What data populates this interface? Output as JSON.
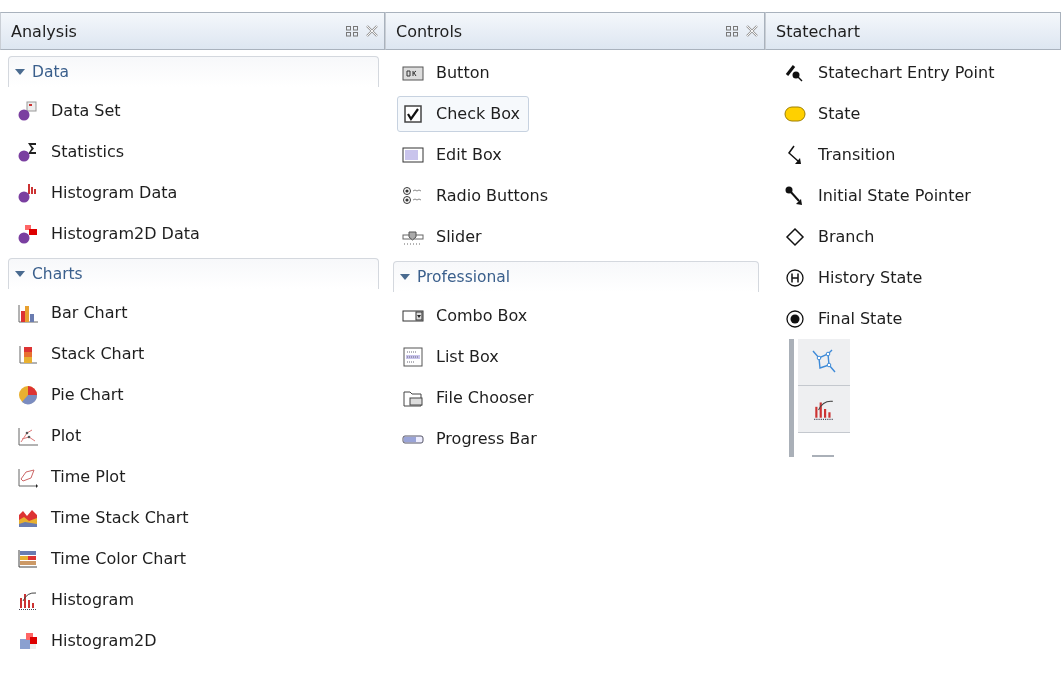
{
  "panels": [
    {
      "title": "Analysis",
      "show_buttons": true,
      "groups": [
        {
          "label": "Data",
          "expanded": true,
          "items": [
            {
              "label": "Data Set",
              "selected": false
            },
            {
              "label": "Statistics",
              "selected": false
            },
            {
              "label": "Histogram Data",
              "selected": false
            },
            {
              "label": "Histogram2D Data",
              "selected": false
            }
          ]
        },
        {
          "label": "Charts",
          "expanded": true,
          "items": [
            {
              "label": "Bar Chart",
              "selected": false
            },
            {
              "label": "Stack Chart",
              "selected": false
            },
            {
              "label": "Pie Chart",
              "selected": false
            },
            {
              "label": "Plot",
              "selected": false
            },
            {
              "label": "Time Plot",
              "selected": false
            },
            {
              "label": "Time Stack Chart",
              "selected": false
            },
            {
              "label": "Time Color Chart",
              "selected": false
            },
            {
              "label": "Histogram",
              "selected": false
            },
            {
              "label": "Histogram2D",
              "selected": false
            }
          ]
        }
      ]
    },
    {
      "title": "Controls",
      "show_buttons": true,
      "groups": [
        {
          "items": [
            {
              "label": "Button",
              "selected": false
            },
            {
              "label": "Check Box",
              "selected": true
            },
            {
              "label": "Edit Box",
              "selected": false
            },
            {
              "label": "Radio Buttons",
              "selected": false
            },
            {
              "label": "Slider",
              "selected": false
            }
          ]
        },
        {
          "label": "Professional",
          "expanded": true,
          "items": [
            {
              "label": "Combo Box",
              "selected": false
            },
            {
              "label": "List Box",
              "selected": false
            },
            {
              "label": "File Chooser",
              "selected": false
            },
            {
              "label": "Progress Bar",
              "selected": false
            }
          ]
        }
      ]
    },
    {
      "title": "Statechart",
      "show_buttons": false,
      "groups": [
        {
          "items": [
            {
              "label": "Statechart Entry Point",
              "selected": false
            },
            {
              "label": "State",
              "selected": false
            },
            {
              "label": "Transition",
              "selected": false
            },
            {
              "label": "Initial State Pointer",
              "selected": false
            },
            {
              "label": "Branch",
              "selected": false
            },
            {
              "label": "History State",
              "selected": false
            },
            {
              "label": "Final State",
              "selected": false
            }
          ]
        }
      ],
      "toolbar": true
    }
  ]
}
